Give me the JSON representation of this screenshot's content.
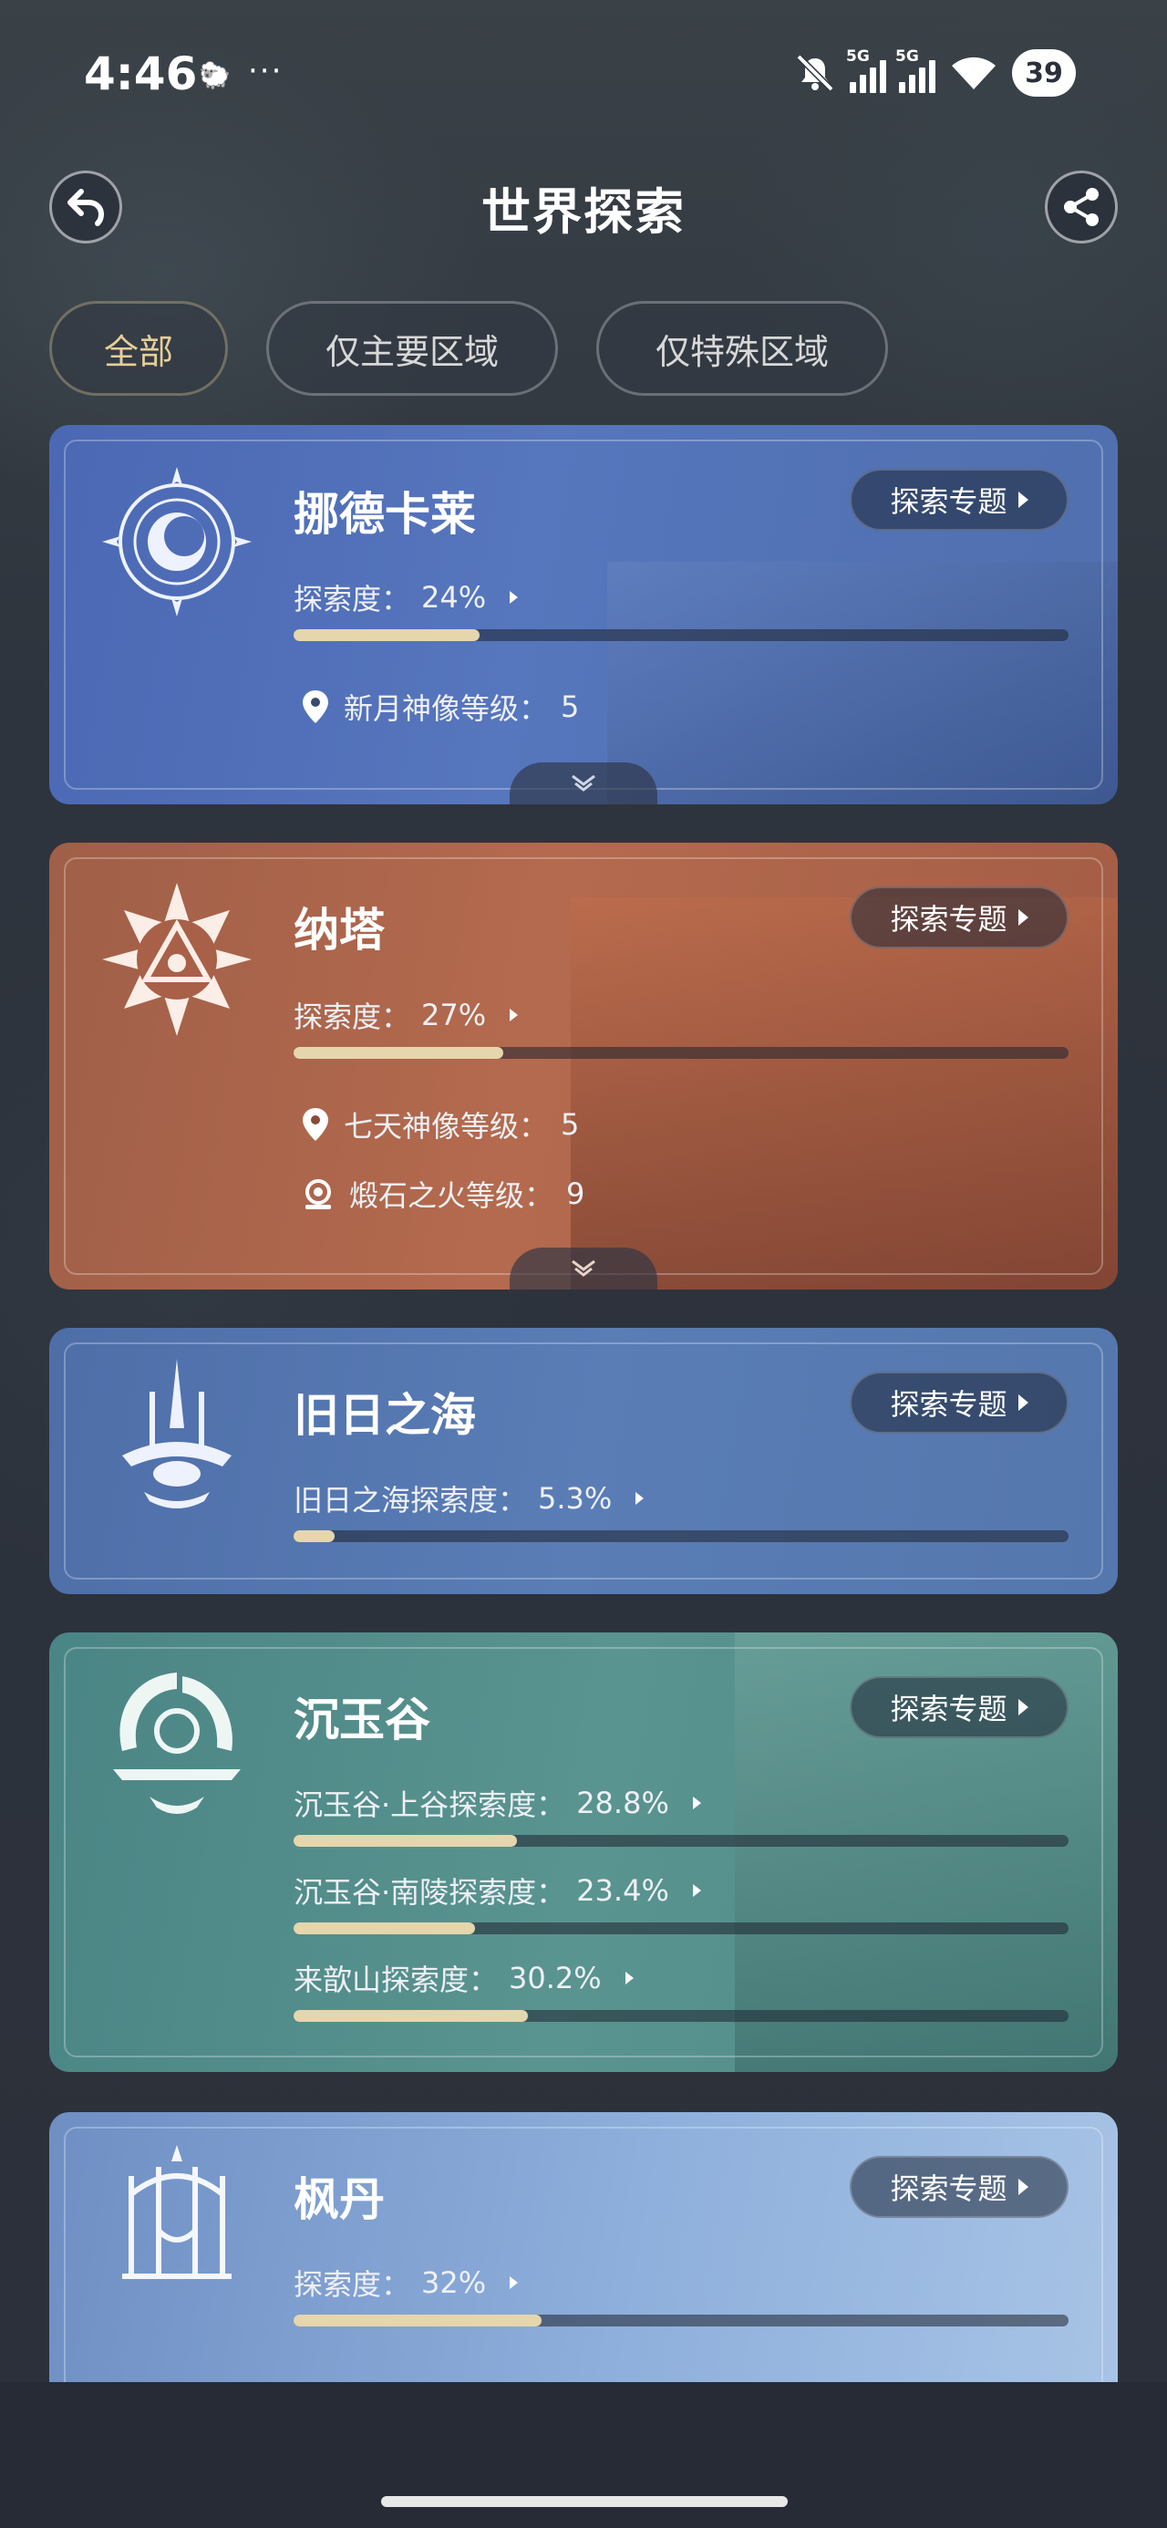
{
  "status_bar": {
    "time": "4:46",
    "more": "···",
    "net1": "5G",
    "net2": "5G",
    "battery": "39"
  },
  "header": {
    "title": "世界探索"
  },
  "filters": [
    {
      "label": "全部",
      "active": true
    },
    {
      "label": "仅主要区域",
      "active": false
    },
    {
      "label": "仅特殊区域",
      "active": false
    }
  ],
  "topic_label": "探索专题",
  "regions": {
    "nodkrai": {
      "name": "挪德卡莱",
      "progress_label": "探索度：",
      "progress_value": "24%",
      "progress_fraction": 0.24,
      "stat1_label": "新月神像等级：",
      "stat1_value": "5"
    },
    "natlan": {
      "name": "纳塔",
      "progress_label": "探索度：",
      "progress_value": "27%",
      "progress_fraction": 0.27,
      "stat1_label": "七天神像等级：",
      "stat1_value": "5",
      "stat2_label": "煅石之火等级：",
      "stat2_value": "9"
    },
    "oldsea": {
      "name": "旧日之海",
      "progress_label": "旧日之海探索度：",
      "progress_value": "5.3%",
      "progress_fraction": 0.053
    },
    "chenyu": {
      "name": "沉玉谷",
      "rows": [
        {
          "label": "沉玉谷·上谷探索度：",
          "value": "28.8%",
          "fraction": 0.288
        },
        {
          "label": "沉玉谷·南陵探索度：",
          "value": "23.4%",
          "fraction": 0.234
        },
        {
          "label": "来歆山探索度：",
          "value": "30.2%",
          "fraction": 0.302
        }
      ]
    },
    "fontaine": {
      "name": "枫丹",
      "progress_label": "探索度：",
      "progress_value": "32%",
      "progress_fraction": 0.32
    }
  }
}
